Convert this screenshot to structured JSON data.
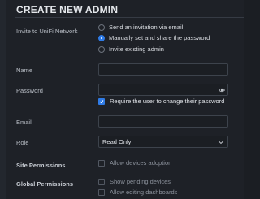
{
  "header": {
    "title": "CREATE NEW ADMIN"
  },
  "invite": {
    "label": "Invite to UniFi Network",
    "options": [
      {
        "label": "Send an invitation via email",
        "selected": false
      },
      {
        "label": "Manually set and share the password",
        "selected": true
      },
      {
        "label": "Invite existing admin",
        "selected": false
      }
    ]
  },
  "name_field": {
    "label": "Name",
    "value": ""
  },
  "password_field": {
    "label": "Password",
    "value": "",
    "require_change_label": "Require the user to change their password",
    "require_change_checked": true
  },
  "email_field": {
    "label": "Email",
    "value": ""
  },
  "role_field": {
    "label": "Role",
    "value": "Read Only"
  },
  "site_permissions": {
    "label": "Site Permissions",
    "options": [
      {
        "label": "Allow devices adoption",
        "checked": false
      }
    ]
  },
  "global_permissions": {
    "label": "Global Permissions",
    "options": [
      {
        "label": "Show pending devices",
        "checked": false
      },
      {
        "label": "Allow editing dashboards",
        "checked": false
      }
    ]
  },
  "colors": {
    "accent": "#2f7be6",
    "background": "#1e2127",
    "border": "#3d434c"
  }
}
